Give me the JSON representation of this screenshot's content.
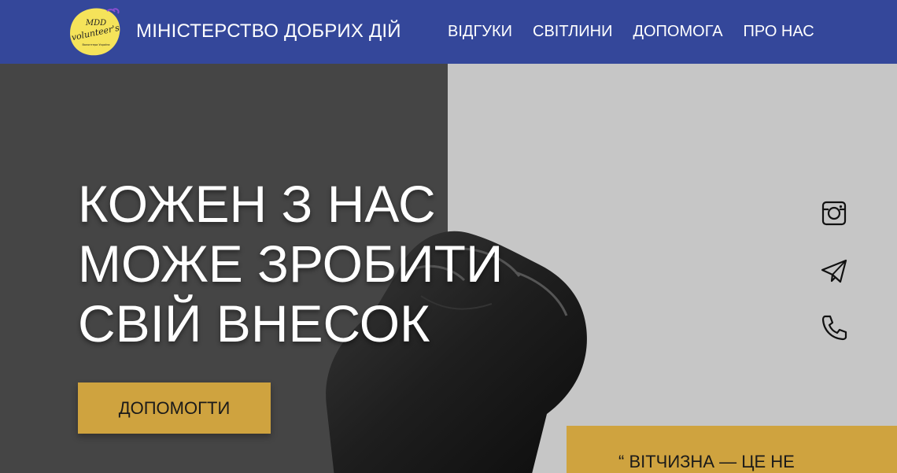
{
  "header": {
    "logo_text_top": "MDD",
    "logo_text_main": "volunteer's",
    "logo_text_sub": "Волонтери Україна",
    "site_title": "МІНІСТЕРСТВО ДОБРИХ ДІЙ",
    "nav": [
      {
        "label": "ВІДГУКИ"
      },
      {
        "label": "СВІТЛИНИ"
      },
      {
        "label": "ДОПОМОГА"
      },
      {
        "label": "ПРО НАС"
      }
    ],
    "bg_color": "#34479a",
    "logo_color": "#f5e35a"
  },
  "hero": {
    "title_lines": [
      "КОЖЕН З НАС",
      "МОЖЕ ЗРОБИТИ",
      "СВІЙ ВНЕСОК"
    ],
    "cta_label": "ДОПОМОГТИ",
    "accent_color": "#cfa33f",
    "quote": "“ ВІТЧИЗНА — ЦЕ НЕ"
  },
  "social": {
    "icons": [
      "instagram-icon",
      "telegram-icon",
      "phone-icon"
    ]
  }
}
